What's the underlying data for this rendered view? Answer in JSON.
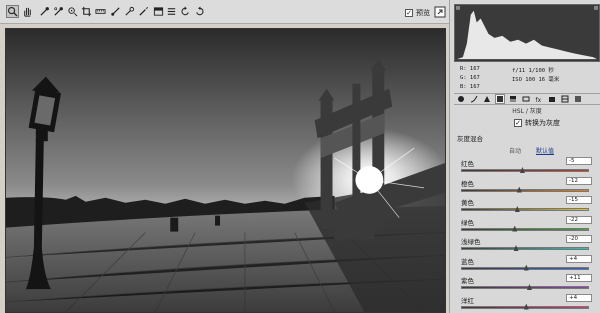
{
  "toolbar": {
    "tools": [
      {
        "name": "zoom-tool",
        "icon": "magnifier-icon"
      },
      {
        "name": "hand-tool",
        "icon": "hand-icon"
      },
      {
        "name": "white-balance-tool",
        "icon": "eyedropper-icon"
      },
      {
        "name": "color-sampler-tool",
        "icon": "color-sampler-icon"
      },
      {
        "name": "targeted-adjustment-tool",
        "icon": "target-adjust-icon"
      },
      {
        "name": "crop-tool",
        "icon": "crop-icon"
      },
      {
        "name": "straighten-tool",
        "icon": "straighten-icon"
      },
      {
        "name": "spot-removal-tool",
        "icon": "brush-icon"
      },
      {
        "name": "red-eye-tool",
        "icon": "red-eye-icon"
      },
      {
        "name": "adjustment-brush-tool",
        "icon": "adjustment-brush-icon"
      },
      {
        "name": "graduated-filter-tool",
        "icon": "graduated-filter-icon"
      },
      {
        "name": "preferences-tool",
        "icon": "preferences-icon"
      },
      {
        "name": "rotate-left-tool",
        "icon": "rotate-ccw-icon"
      },
      {
        "name": "rotate-right-tool",
        "icon": "rotate-cw-icon"
      }
    ],
    "preview_label": "预览",
    "preview_checked": "✓"
  },
  "info": {
    "r": "R:  167",
    "g": "G:  167",
    "b": "B:  167",
    "exposure": "f/11  1/100 秒",
    "iso": "ISO 100  16 毫米"
  },
  "panel": {
    "section_title": "HSL / 灰度",
    "convert_gray_label": "转换为灰度",
    "convert_gray_checked": "✓",
    "mix_title": "灰度混合",
    "auto_label": "自动",
    "default_label": "默认值"
  },
  "sliders": [
    {
      "label": "红色",
      "value": "-5",
      "fraction": 0.48,
      "gradient": [
        "#3a3a3a",
        "#c0392b"
      ]
    },
    {
      "label": "橙色",
      "value": "-12",
      "fraction": 0.455,
      "gradient": [
        "#3a3a3a",
        "#e67e22"
      ]
    },
    {
      "label": "黄色",
      "value": "-15",
      "fraction": 0.44,
      "gradient": [
        "#3a3a3a",
        "#e2c52a"
      ]
    },
    {
      "label": "绿色",
      "value": "-22",
      "fraction": 0.42,
      "gradient": [
        "#3a3a3a",
        "#3aa83a"
      ]
    },
    {
      "label": "浅绿色",
      "value": "-20",
      "fraction": 0.43,
      "gradient": [
        "#3a3a3a",
        "#2ec4b6"
      ]
    },
    {
      "label": "蓝色",
      "value": "+4",
      "fraction": 0.51,
      "gradient": [
        "#3a3a3a",
        "#2f62d6"
      ]
    },
    {
      "label": "紫色",
      "value": "+11",
      "fraction": 0.535,
      "gradient": [
        "#3a3a3a",
        "#8e44ad"
      ]
    },
    {
      "label": "洋红",
      "value": "+4",
      "fraction": 0.51,
      "gradient": [
        "#3a3a3a",
        "#d63384"
      ]
    }
  ],
  "colors": {
    "link": "#1a3b8c",
    "panel_bg": "#d8d8d8",
    "histogram_bg": "#3a3a3a"
  }
}
